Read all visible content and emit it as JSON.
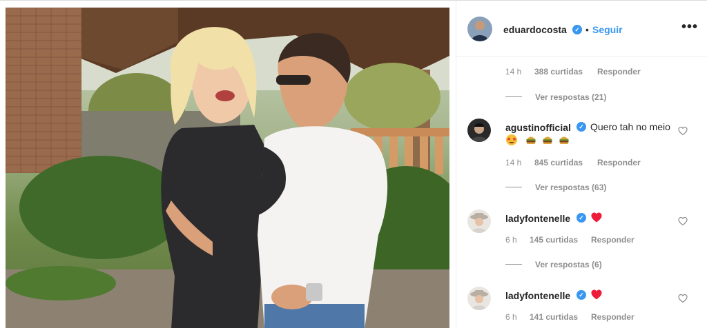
{
  "post": {
    "author": "eduardocosta",
    "follow_label": "Seguir",
    "separator": "•",
    "more_label": "•••"
  },
  "thread_top": {
    "time": "14 h",
    "likes": "388 curtidas",
    "reply_label": "Responder",
    "view_replies": "Ver respostas (21)"
  },
  "comments": [
    {
      "username": "agustinofficial",
      "text": "Quero tah no meio",
      "emoji_icons": [
        "star-struck-emoji-icon",
        "burger-emoji-icon",
        "burger-emoji-icon",
        "burger-emoji-icon"
      ],
      "time": "14 h",
      "likes": "845 curtidas",
      "reply_label": "Responder",
      "view_replies": "Ver respostas (63)"
    },
    {
      "username": "ladyfontenelle",
      "text": "",
      "emoji_icons": [
        "red-heart-emoji-icon"
      ],
      "time": "6 h",
      "likes": "145 curtidas",
      "reply_label": "Responder",
      "view_replies": "Ver respostas (6)"
    },
    {
      "username": "ladyfontenelle",
      "text": "",
      "emoji_icons": [
        "red-heart-emoji-icon"
      ],
      "time": "6 h",
      "likes": "141 curtidas",
      "reply_label": "Responder"
    }
  ],
  "colors": {
    "link_blue": "#3897f0",
    "verified_blue": "#3897f0",
    "meta_gray": "#8e8e8e",
    "text": "#262626",
    "emoji_heart": "#ed4956"
  },
  "icons": [
    "verified-badge-icon",
    "more-options-icon",
    "like-heart-icon"
  ]
}
